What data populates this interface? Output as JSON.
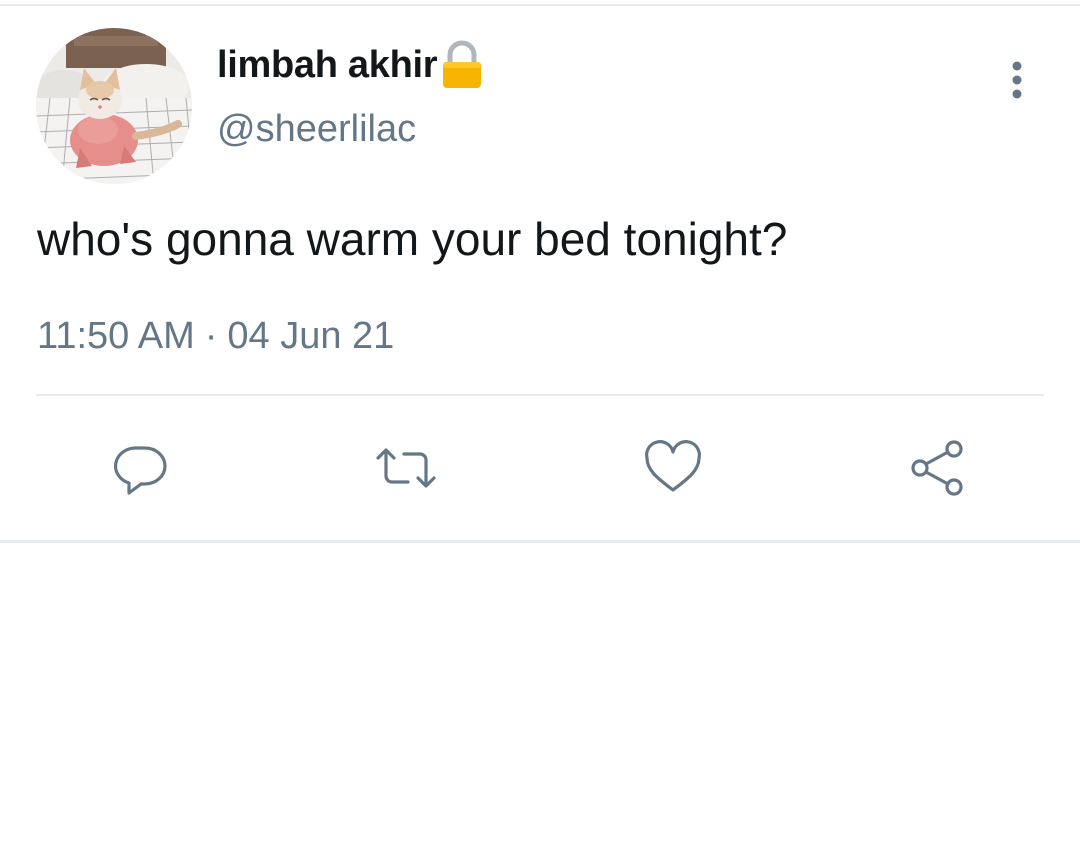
{
  "tweet": {
    "author": {
      "display_name": "limbah akhir",
      "handle": "@sheerlilac",
      "protected_icon": "lock-icon",
      "avatar_description_icon": "cat-avatar"
    },
    "text": "who's gonna warm your bed tonight?",
    "time": "11:50 AM",
    "separator": "·",
    "date": "04 Jun 21"
  },
  "actions": {
    "reply_icon": "reply-icon",
    "retweet_icon": "retweet-icon",
    "like_icon": "heart-icon",
    "share_icon": "share-icon",
    "more_icon": "more-vertical-icon"
  },
  "colors": {
    "text_primary": "#14171a",
    "text_secondary": "#657786",
    "divider": "#e6ecf0",
    "lock_body": "#f7b500",
    "lock_shackle": "#b0b6bd"
  }
}
